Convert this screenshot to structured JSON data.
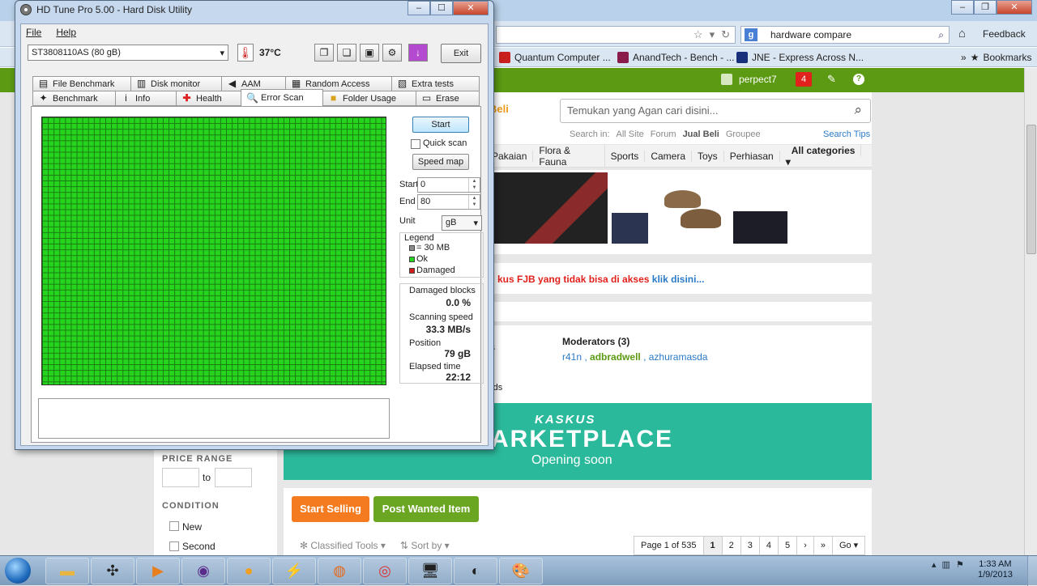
{
  "browser": {
    "search_text": "hardware compare",
    "feedback": "Feedback",
    "bookmarks": [
      {
        "label": "Quantum Computer ...",
        "color": "#c91f1f"
      },
      {
        "label": "AnandTech - Bench - ...",
        "color": "#8a1c4c"
      },
      {
        "label": "JNE - Express Across N...",
        "color": "#1a2f7a"
      }
    ],
    "bookmarks_menu": "Bookmarks",
    "user": "perpect7",
    "notif_count": "4"
  },
  "site": {
    "beli": "Beli",
    "search_placeholder": "Temukan yang Agan cari disini...",
    "search_in_label": "Search in:",
    "search_in": [
      "All Site",
      "Forum",
      "Jual Beli",
      "Groupee"
    ],
    "search_tips": "Search Tips",
    "categories": [
      "Pakaian",
      "Flora & Fauna",
      "Sports",
      "Camera",
      "Toys",
      "Perhiasan"
    ],
    "all_categories": "All categories",
    "notice_red": "kus FJB yang tidak bisa di akses",
    "notice_link": "klik disini...",
    "moderators_title": "Moderators (3)",
    "moderators": [
      "r41n",
      "adbradwell",
      "azhuramasda"
    ],
    "mod_s": "s",
    "mod_rds": "rds",
    "market_logo": "KASKUS",
    "market_title": "ARKETPLACE",
    "market_sub": "Opening soon",
    "price_range": "PRICE RANGE",
    "to": "to",
    "condition": "CONDITION",
    "conditions": [
      "New",
      "Second"
    ],
    "start_selling": "Start Selling",
    "post_wanted": "Post Wanted Item",
    "classified_tools": "Classified Tools",
    "sort_by": "Sort by",
    "pager": [
      "Page 1 of 535",
      "1",
      "2",
      "3",
      "4",
      "5",
      "›",
      "»",
      "Go"
    ]
  },
  "hdtune": {
    "title": "HD Tune Pro 5.00 - Hard Disk Utility",
    "menu": [
      "File",
      "Help"
    ],
    "drive": "ST3808110AS (80 gB)",
    "temperature": "37°C",
    "exit": "Exit",
    "tabs_row1": [
      "File Benchmark",
      "Disk monitor",
      "AAM",
      "Random Access",
      "Extra tests"
    ],
    "tabs_row2": [
      "Benchmark",
      "Info",
      "Health",
      "Error Scan",
      "Folder Usage",
      "Erase"
    ],
    "active_tab": "Error Scan",
    "start": "Start",
    "quick_scan": "Quick scan",
    "speed_map": "Speed map",
    "start_label": "Start",
    "start_value": "0",
    "end_label": "End",
    "end_value": "80",
    "unit_label": "Unit",
    "unit_value": "gB",
    "legend_title": "Legend",
    "legend": [
      {
        "label": "= 30 MB",
        "color": "#8c8c8c"
      },
      {
        "label": "Ok",
        "color": "#26d31d"
      },
      {
        "label": "Damaged",
        "color": "#d41c1c"
      }
    ],
    "stats": [
      {
        "label": "Damaged blocks",
        "value": "0.0 %"
      },
      {
        "label": "Scanning speed",
        "value": "33.3 MB/s"
      },
      {
        "label": "Position",
        "value": "79 gB"
      },
      {
        "label": "Elapsed time",
        "value": "22:12"
      }
    ]
  },
  "taskbar": {
    "clock_time": "1:33 AM",
    "clock_date": "1/9/2013"
  }
}
